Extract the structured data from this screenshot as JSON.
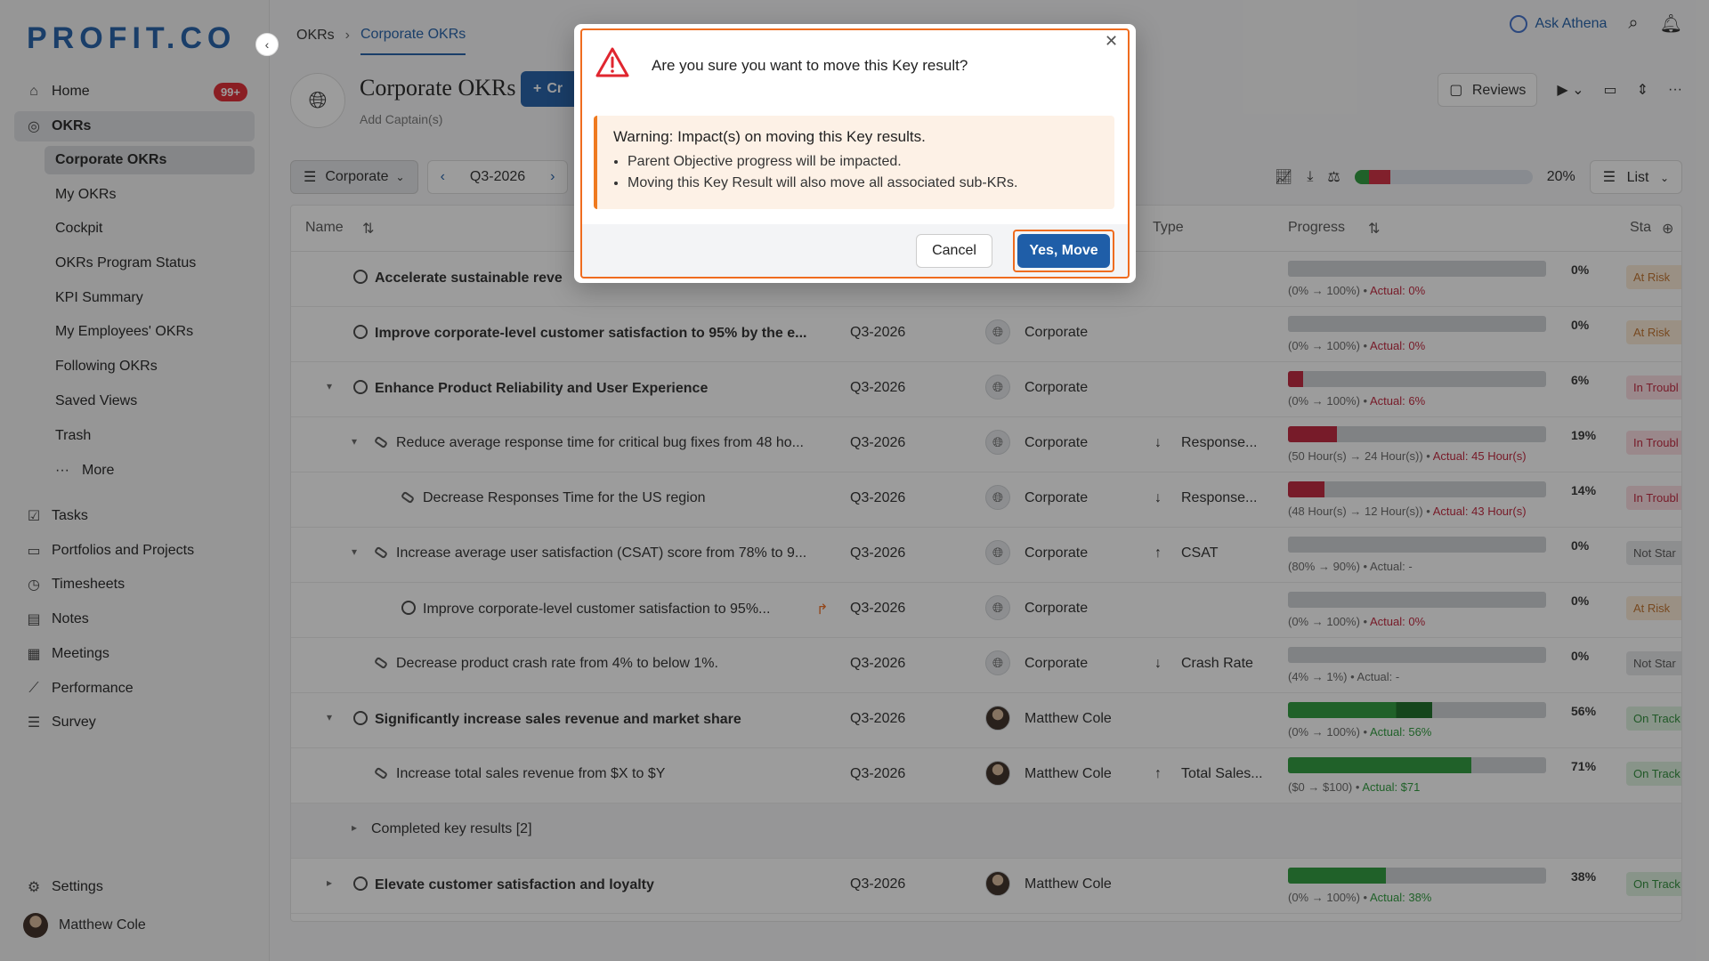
{
  "brand": {
    "logo": "PROFIT.CO",
    "accent": "#1f5ea8"
  },
  "sidebar": {
    "items": [
      {
        "label": "Home",
        "icon": "home-icon",
        "badge": "99+"
      },
      {
        "label": "OKRs",
        "icon": "target-icon"
      }
    ],
    "sub_items": [
      "Corporate OKRs",
      "My OKRs",
      "Cockpit",
      "OKRs Program Status",
      "KPI Summary",
      "My Employees' OKRs",
      "Following OKRs",
      "Saved Views",
      "Trash",
      "More"
    ],
    "bottom_items": [
      {
        "label": "Tasks",
        "icon": "tasks-icon"
      },
      {
        "label": "Portfolios and Projects",
        "icon": "briefcase-icon"
      },
      {
        "label": "Timesheets",
        "icon": "timer-icon"
      },
      {
        "label": "Notes",
        "icon": "notes-icon"
      },
      {
        "label": "Meetings",
        "icon": "calendar-icon"
      },
      {
        "label": "Performance",
        "icon": "chart-icon"
      },
      {
        "label": "Survey",
        "icon": "survey-icon"
      }
    ],
    "settings": "Settings",
    "user": "Matthew Cole"
  },
  "topbar": {
    "crumb_root": "OKRs",
    "crumb_current": "Corporate OKRs",
    "ask": "Ask Athena"
  },
  "page": {
    "title": "Corporate OKRs",
    "add_captain": "Add Captain(s)",
    "create_label": "Cr",
    "reviews": "Reviews",
    "filter": "Corporate",
    "quarter": "Q3-2026",
    "overall_pct": "20%",
    "view": "List"
  },
  "table": {
    "headers": {
      "name": "Name",
      "type": "Type",
      "progress": "Progress",
      "status": "Sta"
    },
    "rows": [
      {
        "name": "Accelerate sustainable reve",
        "period": "",
        "owner": "",
        "type": "",
        "pct": "0%",
        "range": "(0% → 100%) • ",
        "actual": "Actual: 0%",
        "status": "At Risk"
      },
      {
        "name": "Improve corporate-level customer satisfaction to 95% by the e...",
        "period": "Q3-2026",
        "owner": "Corporate",
        "type": "",
        "pct": "0%",
        "range": "(0% → 100%) • ",
        "actual": "Actual: 0%",
        "status": "At Risk"
      },
      {
        "name": "Enhance Product Reliability and User Experience",
        "period": "Q3-2026",
        "owner": "Corporate",
        "type": "",
        "pct": "6%",
        "range": "(0% → 100%) • ",
        "actual": "Actual: 6%",
        "status": "In Troubl"
      },
      {
        "name": "Reduce average response time for critical bug fixes from 48 ho...",
        "period": "Q3-2026",
        "owner": "Corporate",
        "type": "Response...",
        "pct": "19%",
        "range": "(50 Hour(s) → 24 Hour(s)) • ",
        "actual": "Actual: 45 Hour(s)",
        "status": "In Troubl"
      },
      {
        "name": "Decrease Responses Time for the US region",
        "period": "Q3-2026",
        "owner": "Corporate",
        "type": "Response...",
        "pct": "14%",
        "range": "(48 Hour(s) → 12 Hour(s)) • ",
        "actual": "Actual: 43 Hour(s)",
        "status": "In Troubl"
      },
      {
        "name": "Increase average user satisfaction (CSAT) score from 78% to 9...",
        "period": "Q3-2026",
        "owner": "Corporate",
        "type": "CSAT",
        "pct": "0%",
        "range": "(80% → 90%) • ",
        "actual": "Actual: -",
        "status": "Not Star"
      },
      {
        "name": "Improve corporate-level customer satisfaction to 95%...",
        "period": "Q3-2026",
        "owner": "Corporate",
        "type": "",
        "pct": "0%",
        "range": "(0% → 100%) • ",
        "actual": "Actual: 0%",
        "status": "At Risk"
      },
      {
        "name": "Decrease product crash rate from 4% to below 1%.",
        "period": "Q3-2026",
        "owner": "Corporate",
        "type": "Crash Rate",
        "pct": "0%",
        "range": "(4% → 1%) • ",
        "actual": "Actual: -",
        "status": "Not Star"
      },
      {
        "name": "Significantly increase sales revenue and market share",
        "period": "Q3-2026",
        "owner": "Matthew Cole",
        "type": "",
        "pct": "56%",
        "range": "(0% → 100%) • ",
        "actual": "Actual: 56%",
        "status": "On Track"
      },
      {
        "name": "Increase total sales revenue from $X to $Y",
        "period": "Q3-2026",
        "owner": "Matthew Cole",
        "type": "Total Sales...",
        "pct": "71%",
        "range": "($0 → $100) • ",
        "actual": "Actual: $71",
        "status": "On Track"
      },
      {
        "name": "Completed key results [2]"
      },
      {
        "name": "Elevate customer satisfaction and loyalty",
        "period": "Q3-2026",
        "owner": "Matthew Cole",
        "type": "",
        "pct": "38%",
        "range": "(0% → 100%) • ",
        "actual": "Actual: 38%",
        "status": "On Track"
      }
    ]
  },
  "modal": {
    "question": "Are you sure you want to move this Key result?",
    "warning_title": "Warning: Impact(s) on moving this Key results.",
    "warning_items": [
      "Parent Objective progress will be impacted.",
      "Moving this Key Result will also move all associated sub-KRs."
    ],
    "cancel": "Cancel",
    "confirm": "Yes, Move",
    "highlight_color": "#ef6c1f"
  }
}
